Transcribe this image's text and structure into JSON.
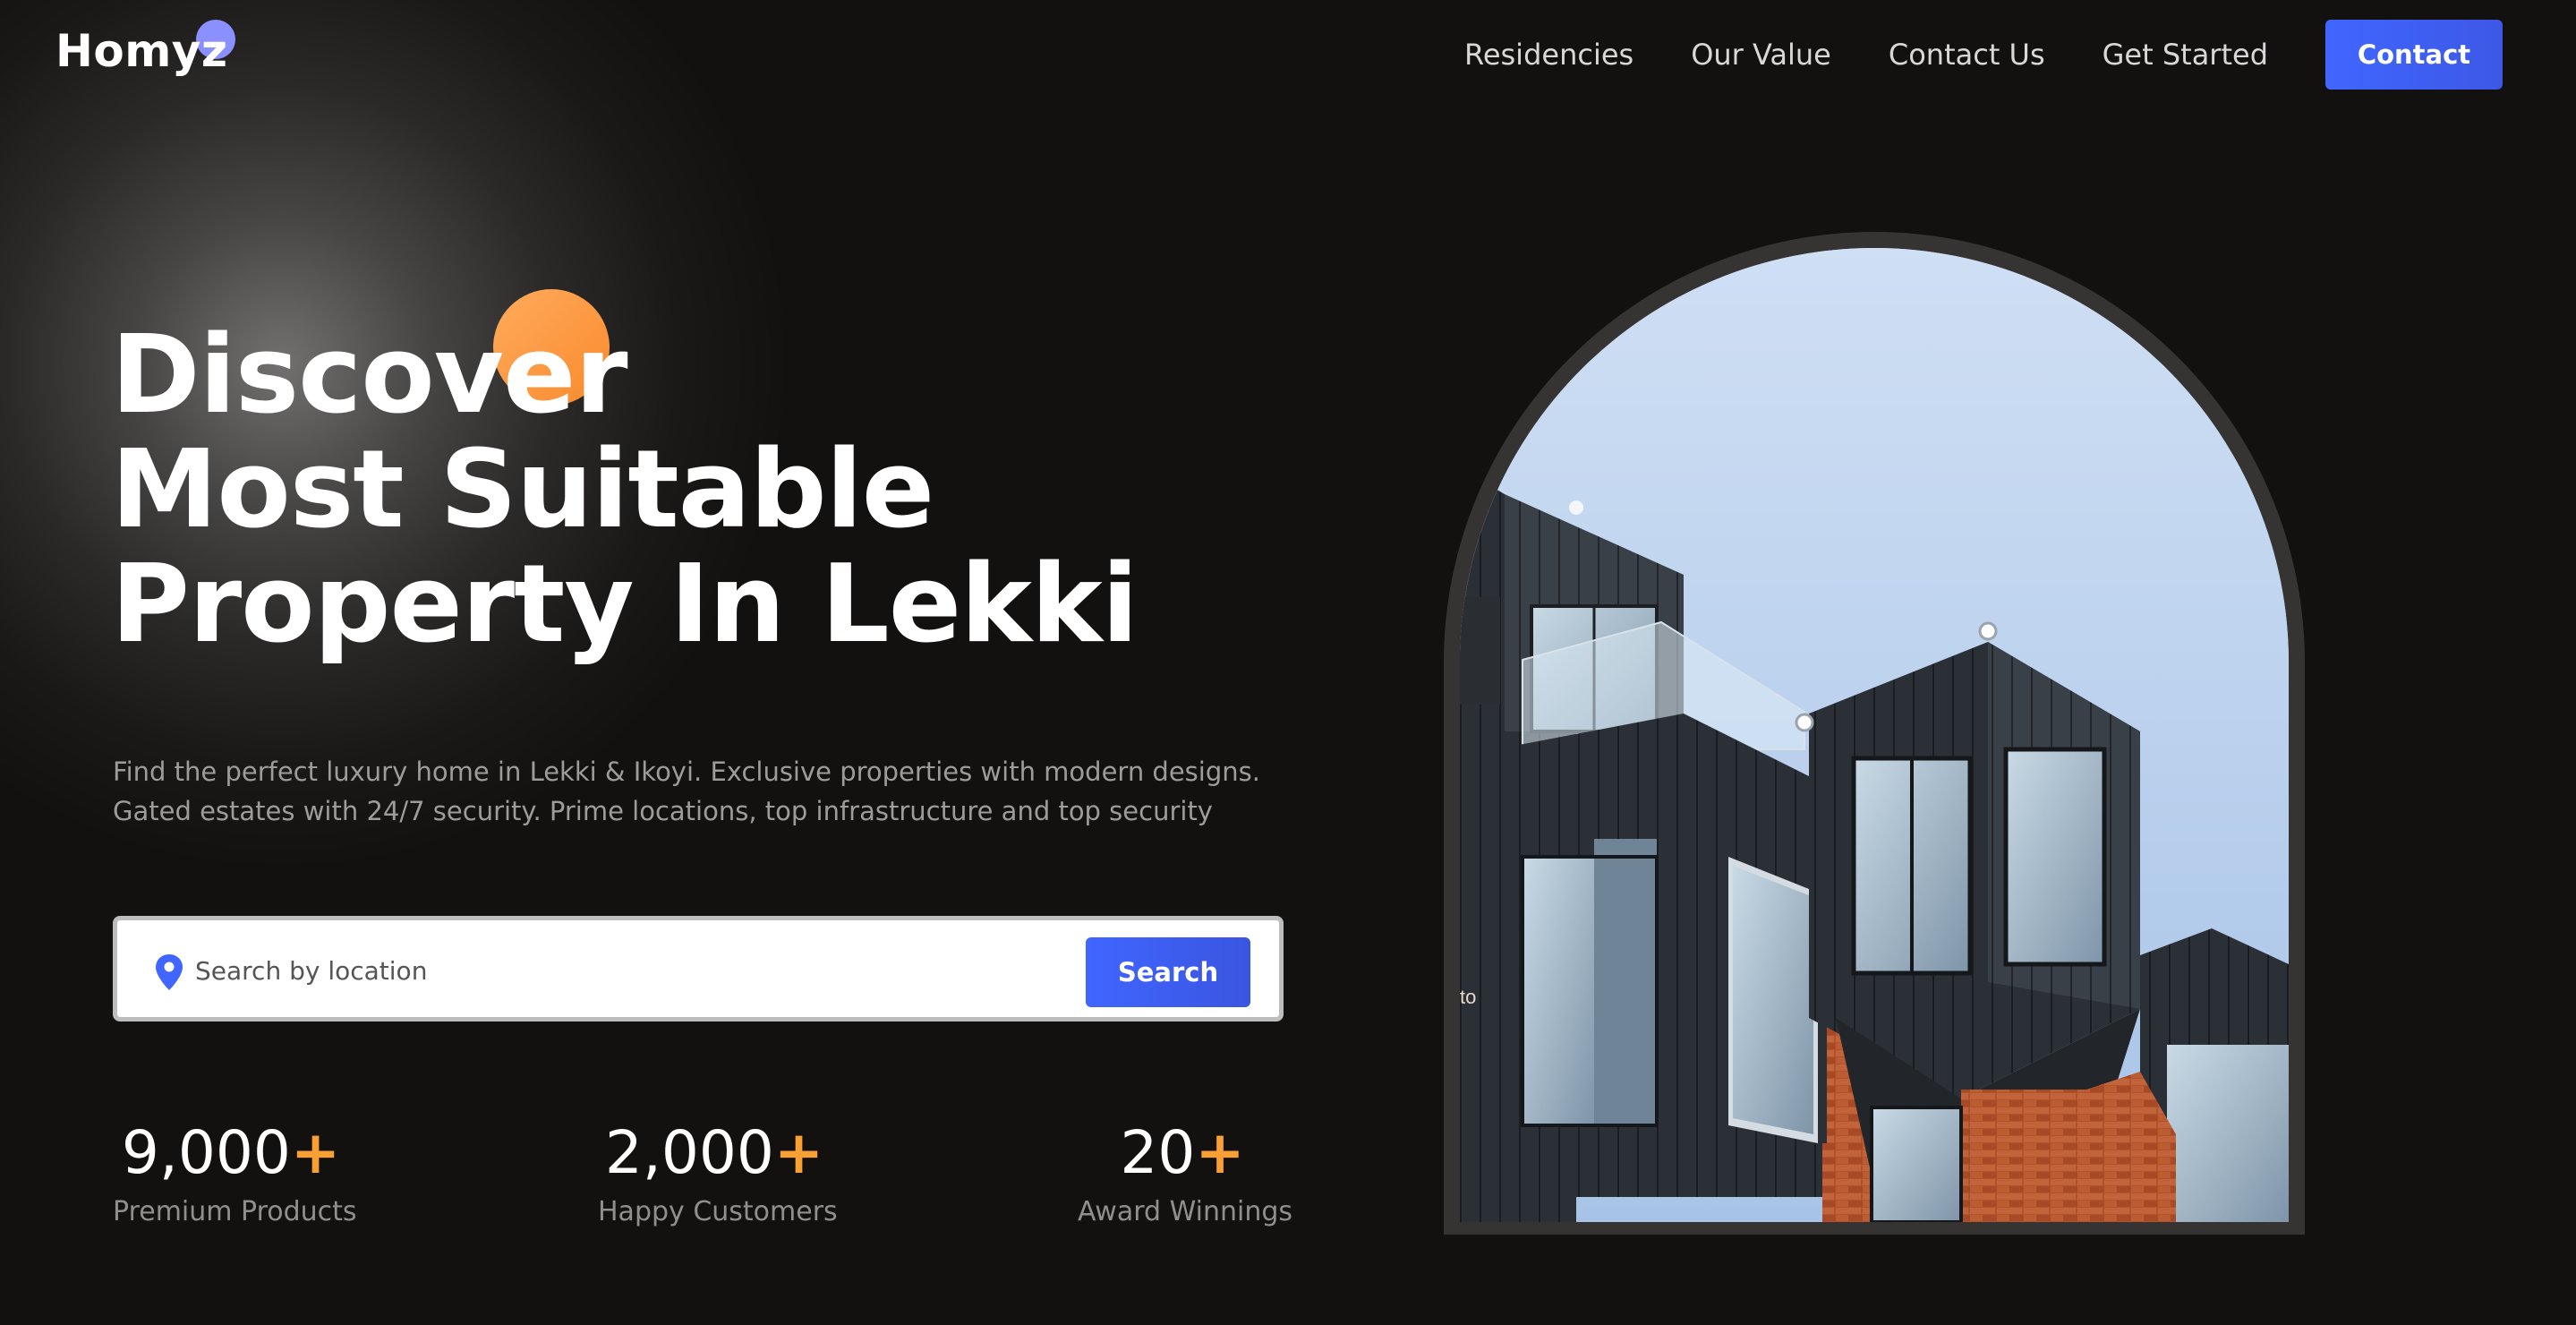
{
  "header": {
    "logo_text": "Homyz",
    "nav": [
      {
        "label": "Residencies"
      },
      {
        "label": "Our Value"
      },
      {
        "label": "Contact Us"
      },
      {
        "label": "Get Started"
      }
    ],
    "contact_label": "Contact"
  },
  "hero": {
    "title_lines": [
      "Discover",
      "Most Suitable",
      "Property In Lekki"
    ],
    "description_lines": [
      "Find the perfect luxury home in Lekki & Ikoyi. Exclusive properties with modern designs.",
      "Gated estates with 24/7 security. Prime locations, top infrastructure and top security"
    ]
  },
  "search": {
    "placeholder": "Search by location",
    "button_label": "Search",
    "icon": "location-pin-icon"
  },
  "stats": [
    {
      "value": "9,000",
      "plus": "+",
      "label": "Premium Products"
    },
    {
      "value": "2,000",
      "plus": "+",
      "label": "Happy Customers"
    },
    {
      "value": "20",
      "plus": "+",
      "label": "Award Winnings"
    }
  ],
  "hero_image": {
    "overlay_text": "to"
  },
  "colors": {
    "background": "#131110",
    "accent_blue": "#4066ff",
    "accent_orange": "#f8a033",
    "logo_dot": "#8a90ff"
  }
}
